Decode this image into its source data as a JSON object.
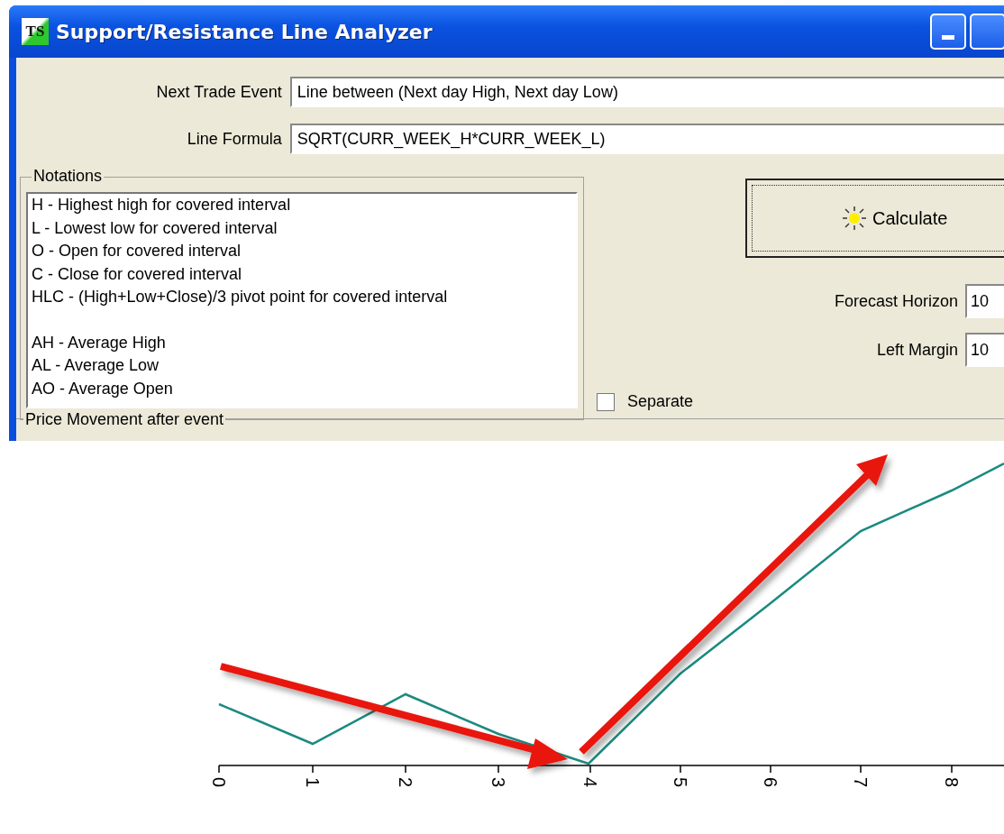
{
  "window": {
    "title": "Support/Resistance Line Analyzer",
    "icon_text": "TS"
  },
  "fields": [
    {
      "label": "Next Trade Event",
      "value": "Line between (Next day High, Next day Low)"
    },
    {
      "label": "Line Formula",
      "value": "SQRT(CURR_WEEK_H*CURR_WEEK_L)"
    }
  ],
  "notations": {
    "title": "Notations",
    "groups": [
      [
        "H - Highest high for covered interval",
        "L - Lowest low for covered interval",
        "O - Open for covered interval",
        "C - Close for covered interval",
        "HLC - (High+Low+Close)/3  pivot point for covered interval"
      ],
      [
        "AH - Average High",
        "AL - Average Low",
        "AO - Average Open"
      ]
    ]
  },
  "separate": {
    "label": "Separate",
    "checked": false
  },
  "calculate_button": {
    "label": "Calculate"
  },
  "settings": [
    {
      "label": "Forecast Horizon",
      "value": "10"
    },
    {
      "label": "Left Margin",
      "value": "10"
    }
  ],
  "chart_panel": {
    "title": "Price Movement after event",
    "x_axis_labels": [
      "0",
      "1",
      "2",
      "3",
      "4",
      "5",
      "6",
      "7",
      "8"
    ]
  }
}
